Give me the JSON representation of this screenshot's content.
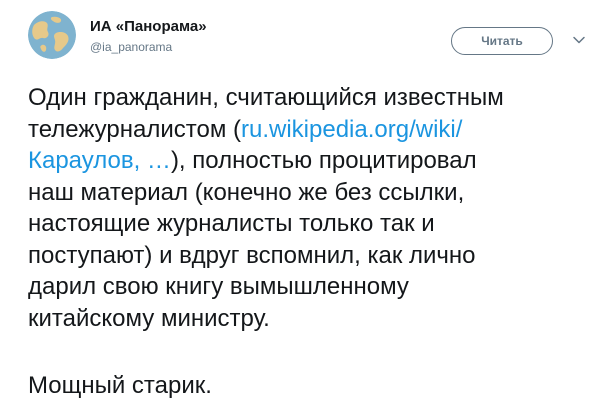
{
  "author": {
    "display_name": "ИА «Панорама»",
    "screen_name": "@ia_panorama"
  },
  "follow_button_label": "Читать",
  "tweet": {
    "text_before_link": "Один гражданин, считающийся известным\nтележурналистом (",
    "link_text": "ru.wikipedia.org/wiki/\nКараулов, …",
    "text_after_link": "), полностью процитировал\nнаш материал (конечно же без ссылки,\nнастоящие журналисты только так и\nпоступают) и вдруг вспомнил, как лично\nдарил свою книгу вымышленному\nкитайскому министру.",
    "closing_line": "Мощный старик."
  },
  "colors": {
    "text": "#14171a",
    "secondary": "#657786",
    "link": "#1b95e0",
    "avatar_ocean": "#7fb3cf",
    "avatar_land": "#e6c98a"
  },
  "icons": {
    "avatar": "globe-avatar",
    "menu": "chevron-down-icon"
  }
}
